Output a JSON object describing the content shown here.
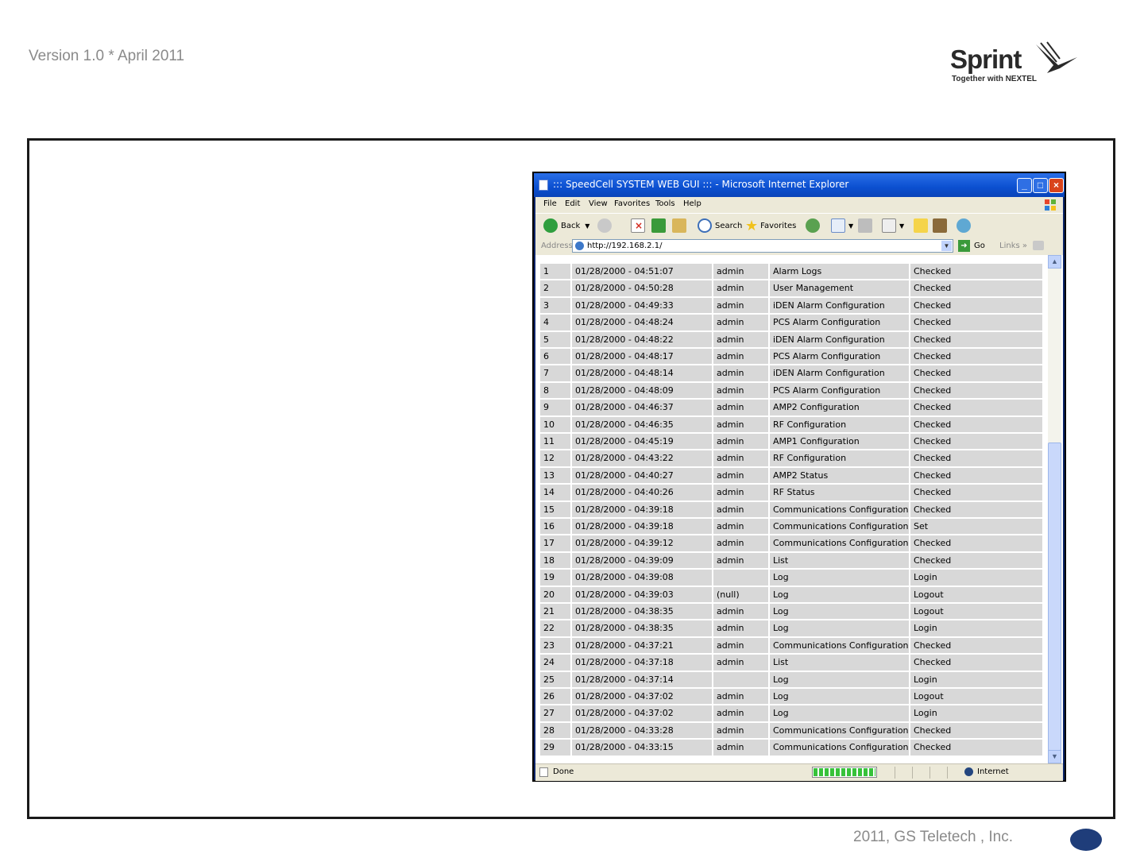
{
  "slide": {
    "version": "Version 1.0 * April 2011",
    "footer": "2011, GS Teletech , Inc.",
    "logo": {
      "word": "Sprint",
      "tagline": "Together with NEXTEL"
    }
  },
  "browser": {
    "title": "::: SpeedCell SYSTEM WEB GUI ::: - Microsoft Internet Explorer",
    "menu": [
      "File",
      "Edit",
      "View",
      "Favorites",
      "Tools",
      "Help"
    ],
    "toolbar": {
      "back": "Back",
      "search": "Search",
      "favorites": "Favorites"
    },
    "address_label": "Address",
    "address": "http://192.168.2.1/",
    "go": "Go",
    "links": "Links",
    "status": "Done",
    "progress": 1.0,
    "zone": "Internet"
  },
  "log_table": {
    "rows": [
      [
        "1",
        "01/28/2000 - 04:51:07",
        "admin",
        "Alarm Logs",
        "Checked"
      ],
      [
        "2",
        "01/28/2000 - 04:50:28",
        "admin",
        "User Management",
        "Checked"
      ],
      [
        "3",
        "01/28/2000 - 04:49:33",
        "admin",
        "iDEN Alarm Configuration",
        "Checked"
      ],
      [
        "4",
        "01/28/2000 - 04:48:24",
        "admin",
        "PCS Alarm Configuration",
        "Checked"
      ],
      [
        "5",
        "01/28/2000 - 04:48:22",
        "admin",
        "iDEN Alarm Configuration",
        "Checked"
      ],
      [
        "6",
        "01/28/2000 - 04:48:17",
        "admin",
        "PCS Alarm Configuration",
        "Checked"
      ],
      [
        "7",
        "01/28/2000 - 04:48:14",
        "admin",
        "iDEN Alarm Configuration",
        "Checked"
      ],
      [
        "8",
        "01/28/2000 - 04:48:09",
        "admin",
        "PCS Alarm Configuration",
        "Checked"
      ],
      [
        "9",
        "01/28/2000 - 04:46:37",
        "admin",
        "AMP2 Configuration",
        "Checked"
      ],
      [
        "10",
        "01/28/2000 - 04:46:35",
        "admin",
        "RF Configuration",
        "Checked"
      ],
      [
        "11",
        "01/28/2000 - 04:45:19",
        "admin",
        "AMP1 Configuration",
        "Checked"
      ],
      [
        "12",
        "01/28/2000 - 04:43:22",
        "admin",
        "RF Configuration",
        "Checked"
      ],
      [
        "13",
        "01/28/2000 - 04:40:27",
        "admin",
        "AMP2 Status",
        "Checked"
      ],
      [
        "14",
        "01/28/2000 - 04:40:26",
        "admin",
        "RF Status",
        "Checked"
      ],
      [
        "15",
        "01/28/2000 - 04:39:18",
        "admin",
        "Communications Configuration",
        "Checked"
      ],
      [
        "16",
        "01/28/2000 - 04:39:18",
        "admin",
        "Communications Configuration",
        "Set"
      ],
      [
        "17",
        "01/28/2000 - 04:39:12",
        "admin",
        "Communications Configuration",
        "Checked"
      ],
      [
        "18",
        "01/28/2000 - 04:39:09",
        "admin",
        "List",
        "Checked"
      ],
      [
        "19",
        "01/28/2000 - 04:39:08",
        "",
        "Log",
        "Login"
      ],
      [
        "20",
        "01/28/2000 - 04:39:03",
        "(null)",
        "Log",
        "Logout"
      ],
      [
        "21",
        "01/28/2000 - 04:38:35",
        "admin",
        "Log",
        "Logout"
      ],
      [
        "22",
        "01/28/2000 - 04:38:35",
        "admin",
        "Log",
        "Login"
      ],
      [
        "23",
        "01/28/2000 - 04:37:21",
        "admin",
        "Communications Configuration",
        "Checked"
      ],
      [
        "24",
        "01/28/2000 - 04:37:18",
        "admin",
        "List",
        "Checked"
      ],
      [
        "25",
        "01/28/2000 - 04:37:14",
        "",
        "Log",
        "Login"
      ],
      [
        "26",
        "01/28/2000 - 04:37:02",
        "admin",
        "Log",
        "Logout"
      ],
      [
        "27",
        "01/28/2000 - 04:37:02",
        "admin",
        "Log",
        "Login"
      ],
      [
        "28",
        "01/28/2000 - 04:33:28",
        "admin",
        "Communications Configuration",
        "Checked"
      ],
      [
        "29",
        "01/28/2000 - 04:33:15",
        "admin",
        "Communications Configuration",
        "Checked"
      ]
    ]
  }
}
